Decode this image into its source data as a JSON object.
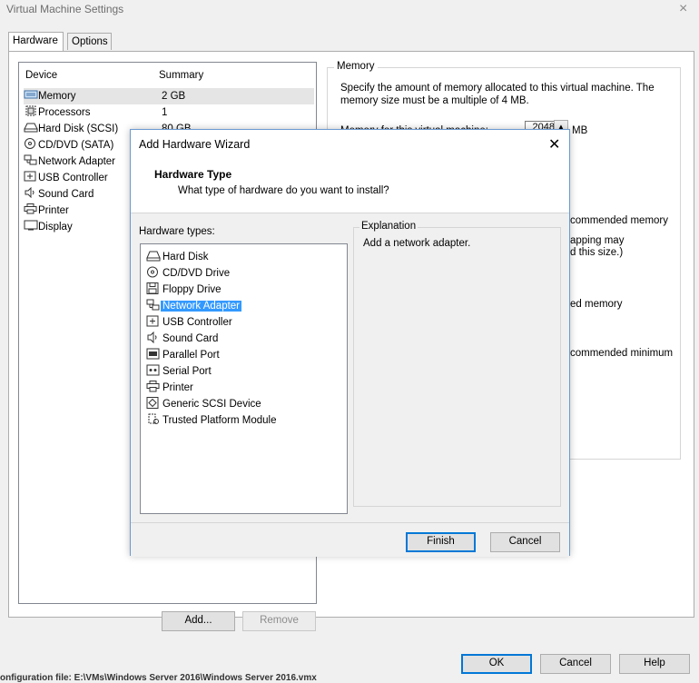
{
  "window": {
    "title": "Virtual Machine Settings",
    "close_glyph": "×"
  },
  "tabs": [
    "Hardware",
    "Options"
  ],
  "device_list": {
    "col_device": "Device",
    "col_summary": "Summary",
    "rows": [
      {
        "name": "Memory",
        "summary": "2 GB",
        "icon": "memory-icon"
      },
      {
        "name": "Processors",
        "summary": "1",
        "icon": "processor-icon"
      },
      {
        "name": "Hard Disk (SCSI)",
        "summary": "80 GB",
        "icon": "hard-disk-icon"
      },
      {
        "name": "CD/DVD (SATA)",
        "summary": "",
        "icon": "cd-dvd-icon"
      },
      {
        "name": "Network Adapter",
        "summary": "",
        "icon": "network-adapter-icon"
      },
      {
        "name": "USB Controller",
        "summary": "",
        "icon": "usb-icon"
      },
      {
        "name": "Sound Card",
        "summary": "",
        "icon": "sound-icon"
      },
      {
        "name": "Printer",
        "summary": "",
        "icon": "printer-icon"
      },
      {
        "name": "Display",
        "summary": "",
        "icon": "display-icon"
      }
    ],
    "add_button": "Add...",
    "remove_button": "Remove"
  },
  "memory_panel": {
    "legend": "Memory",
    "description": "Specify the amount of memory allocated to this virtual machine. The memory size must be a multiple of 4 MB.",
    "field_label": "Memory for this virtual machine:",
    "value": "2048",
    "unit": "MB",
    "fragments": [
      "commended memory",
      "apping may",
      "d this size.)",
      "ed memory",
      "commended minimum"
    ]
  },
  "wizard": {
    "title": "Add Hardware Wizard",
    "close_glyph": "✕",
    "heading": "Hardware Type",
    "subheading": "What type of hardware do you want to install?",
    "types_label": "Hardware types:",
    "hardware_types": [
      {
        "label": "Hard Disk",
        "icon": "hard-disk-icon"
      },
      {
        "label": "CD/DVD Drive",
        "icon": "cd-dvd-icon"
      },
      {
        "label": "Floppy Drive",
        "icon": "floppy-icon"
      },
      {
        "label": "Network Adapter",
        "icon": "network-adapter-icon",
        "selected": true
      },
      {
        "label": "USB Controller",
        "icon": "usb-icon"
      },
      {
        "label": "Sound Card",
        "icon": "sound-icon"
      },
      {
        "label": "Parallel Port",
        "icon": "parallel-port-icon"
      },
      {
        "label": "Serial Port",
        "icon": "serial-port-icon"
      },
      {
        "label": "Printer",
        "icon": "printer-icon"
      },
      {
        "label": "Generic SCSI Device",
        "icon": "scsi-icon"
      },
      {
        "label": "Trusted Platform Module",
        "icon": "tpm-icon"
      }
    ],
    "explanation_legend": "Explanation",
    "explanation_text": "Add a network adapter.",
    "finish_button": "Finish",
    "cancel_button": "Cancel"
  },
  "footer": {
    "ok_button": "OK",
    "cancel_button": "Cancel",
    "help_button": "Help"
  },
  "statusbar_text": "onfiguration file: E:\\VMs\\Windows Server 2016\\Windows Server 2016.vmx",
  "colors": {
    "selection": "#3399ff",
    "accent": "#0078d7"
  }
}
